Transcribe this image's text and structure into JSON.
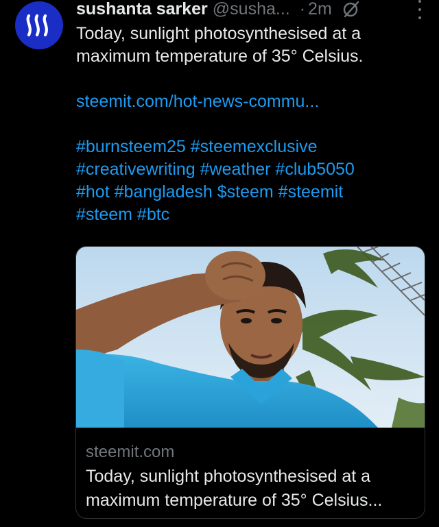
{
  "tweet": {
    "author": {
      "name": "sushanta sarker",
      "handle": "@susha...",
      "avatar_icon": "steem-logo-icon",
      "avatar_color": "#1a2ec6"
    },
    "separator": "·",
    "time": "2m",
    "header_icons": [
      "grok-icon",
      "more-options-icon"
    ],
    "text": "Today, sunlight photosynthesised at a maximum temperature of 35° Celsius.",
    "link": "steemit.com/hot-news-commu...",
    "hashtags": [
      "#burnsteem25 #steemexclusive",
      "#creativewriting #weather #club5050",
      "#hot #bangladesh $steem #steemit",
      "#steem #btc"
    ],
    "link_color": "#1d9bf0"
  },
  "card": {
    "image_icon": "selfie-photo",
    "domain": "steemit.com",
    "title_line1": "Today, sunlight photosynthesised at a",
    "title_line2": "maximum temperature of 35° Celsius..."
  }
}
